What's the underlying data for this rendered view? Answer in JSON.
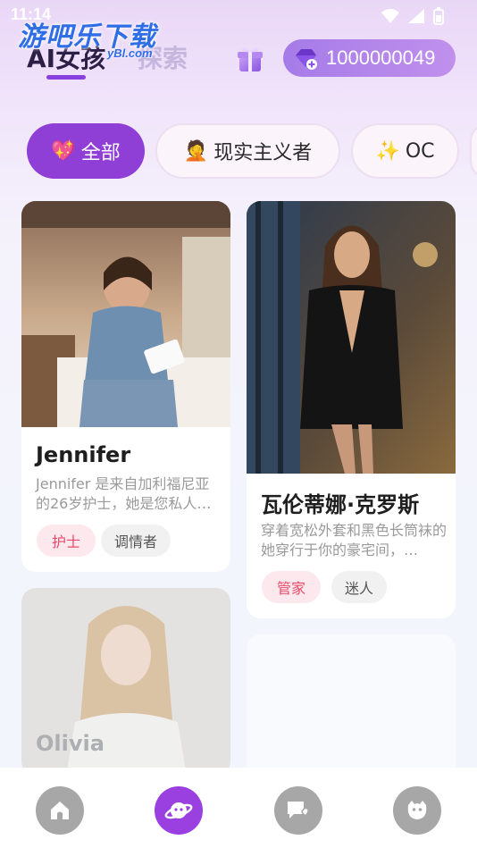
{
  "status": {
    "time": "11:14"
  },
  "watermark": {
    "text": "游吧乐下载",
    "sub": "yBl.com"
  },
  "header": {
    "tab_active": "AI女孩",
    "tab_explore": "探索",
    "gift_icon": "gift-box-icon",
    "coin_icon": "gem-coin-icon",
    "coins": "1000000049"
  },
  "filters": [
    {
      "emoji": "💖",
      "label": "全部"
    },
    {
      "emoji": "🤦",
      "label": "现实主义者"
    },
    {
      "emoji": "✨",
      "label": "OC"
    }
  ],
  "cards": [
    {
      "name": "Jennifer",
      "desc": "Jennifer 是来自加利福尼亚的26岁护士，她是您私人…",
      "tags": [
        "护士",
        "调情者"
      ]
    },
    {
      "name": "瓦伦蒂娜·克罗斯",
      "desc": "穿着宽松外套和黑色长筒袜的她穿行于你的豪宅间，…",
      "tags": [
        "管家",
        "迷人"
      ]
    },
    {
      "name": "Olivia"
    }
  ],
  "nav": [
    "home-icon",
    "planet-icon",
    "chat-heart-icon",
    "face-icon"
  ],
  "colors": {
    "accent": "#8f3fd6",
    "tag_pink": "#ea4a6a"
  }
}
